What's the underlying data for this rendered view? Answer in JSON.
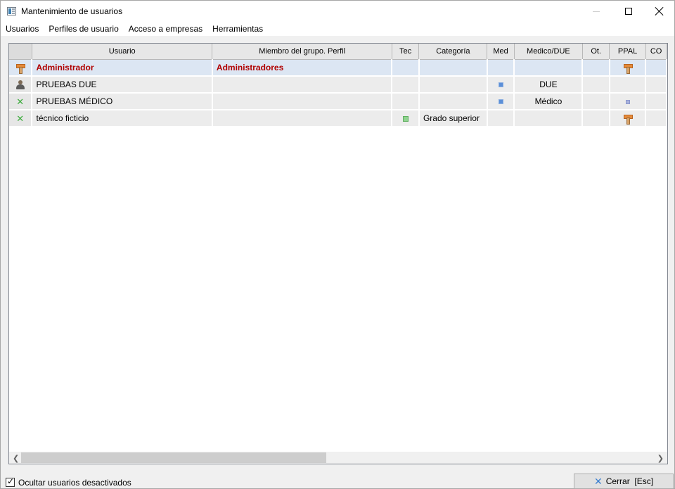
{
  "window": {
    "title": "Mantenimiento de usuarios"
  },
  "menu": [
    "Usuarios",
    "Perfiles de usuario",
    "Acceso a empresas",
    "Herramientas"
  ],
  "grid": {
    "columns": [
      "Usuario",
      "Miembro del grupo. Perfil",
      "Tec",
      "Categoría",
      "Med",
      "Medico/DUE",
      "Ot.",
      "PPAL",
      "CO"
    ],
    "rows": [
      {
        "icon": "admin-hammer-icon",
        "usuario": "Administrador",
        "miembro": "Administradores",
        "tec": "",
        "categoria": "",
        "med": "",
        "medico_due": "",
        "ot": "",
        "ppal": "hammer-icon",
        "selected": true
      },
      {
        "icon": "user-icon",
        "usuario": "PRUEBAS DUE",
        "miembro": "",
        "tec": "",
        "categoria": "",
        "med": "blue-square",
        "medico_due": "DUE",
        "ot": "",
        "ppal": "",
        "selected": false
      },
      {
        "icon": "green-x-icon",
        "usuario": "PRUEBAS MÉDICO",
        "miembro": "",
        "tec": "",
        "categoria": "",
        "med": "blue-square",
        "medico_due": "Médico",
        "ot": "",
        "ppal": "lilac-square",
        "selected": false
      },
      {
        "icon": "green-x-icon",
        "usuario": "técnico ficticio",
        "miembro": "",
        "tec": "green-square",
        "categoria": "Grado superior",
        "med": "",
        "medico_due": "",
        "ot": "",
        "ppal": "hammer-icon",
        "selected": false
      }
    ]
  },
  "footer": {
    "checkbox_label": "Ocultar usuarios desactivados",
    "checkbox_checked": true,
    "close_button_label": "Cerrar  [Esc]"
  }
}
